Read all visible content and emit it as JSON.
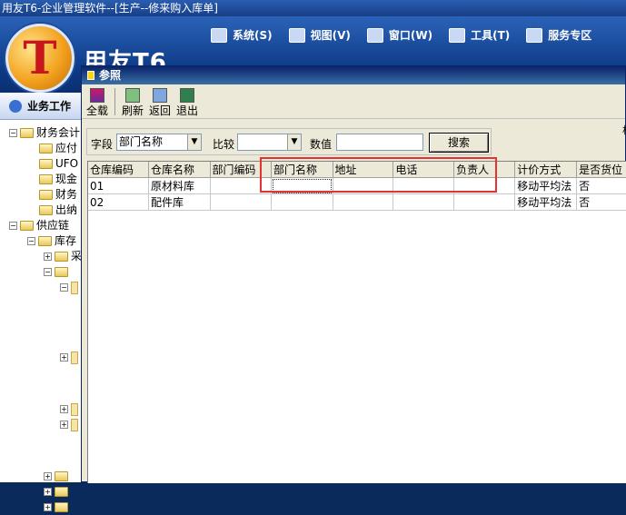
{
  "app": {
    "title": "用友T6-企业管理软件--[生产--修来购入库单]",
    "brand": "用友T6",
    "menus": [
      {
        "label": "系统(S)",
        "icon": "monitor-icon"
      },
      {
        "label": "视图(V)",
        "icon": "grid-icon"
      },
      {
        "label": "窗口(W)",
        "icon": "window-icon"
      },
      {
        "label": "工具(T)",
        "icon": "gear-icon"
      },
      {
        "label": "服务专区",
        "icon": "user-icon"
      }
    ]
  },
  "left_panel": {
    "header": "业务工作",
    "tree": [
      {
        "label": "财务会计",
        "level": 0,
        "type": "folder",
        "expander": "−"
      },
      {
        "label": "应付",
        "level": 1,
        "type": "folder",
        "expander": ""
      },
      {
        "label": "UFO",
        "level": 1,
        "type": "folder",
        "expander": ""
      },
      {
        "label": "现金",
        "level": 1,
        "type": "folder",
        "expander": ""
      },
      {
        "label": "财务",
        "level": 1,
        "type": "folder",
        "expander": ""
      },
      {
        "label": "出纳",
        "level": 1,
        "type": "folder",
        "expander": ""
      },
      {
        "label": "供应链",
        "level": 0,
        "type": "folder",
        "expander": "−"
      },
      {
        "label": "库存",
        "level": 1,
        "type": "folder",
        "expander": "−"
      },
      {
        "label": "采",
        "level": 2,
        "type": "folder",
        "expander": "+"
      },
      {
        "label": "",
        "level": 2,
        "type": "folder",
        "expander": "−"
      }
    ]
  },
  "dialog": {
    "title": "参照",
    "toolbar": [
      {
        "label": "全载",
        "icon": "load-all-icon"
      },
      {
        "label": "刷新",
        "icon": "refresh-icon"
      },
      {
        "label": "返回",
        "icon": "return-icon"
      },
      {
        "label": "退出",
        "icon": "exit-icon"
      }
    ],
    "filter": {
      "field_label": "字段",
      "field_value": "部门名称",
      "compare_label": "比较",
      "compare_value": "",
      "value_label": "数值",
      "value_input": "",
      "search_button": "搜索"
    },
    "side_label": "相",
    "table": {
      "columns": [
        "仓库编码",
        "仓库名称",
        "部门编码",
        "部门名称",
        "地址",
        "电话",
        "负责人",
        "计价方式",
        "是否货位"
      ],
      "rows": [
        [
          "01",
          "原材料库",
          "",
          "",
          "",
          "",
          "",
          "移动平均法",
          "否"
        ],
        [
          "02",
          "配件库",
          "",
          "",
          "",
          "",
          "",
          "移动平均法",
          "否"
        ]
      ]
    }
  },
  "colors": {
    "highlight": "#e53333",
    "title_bar": "#0a246a"
  }
}
